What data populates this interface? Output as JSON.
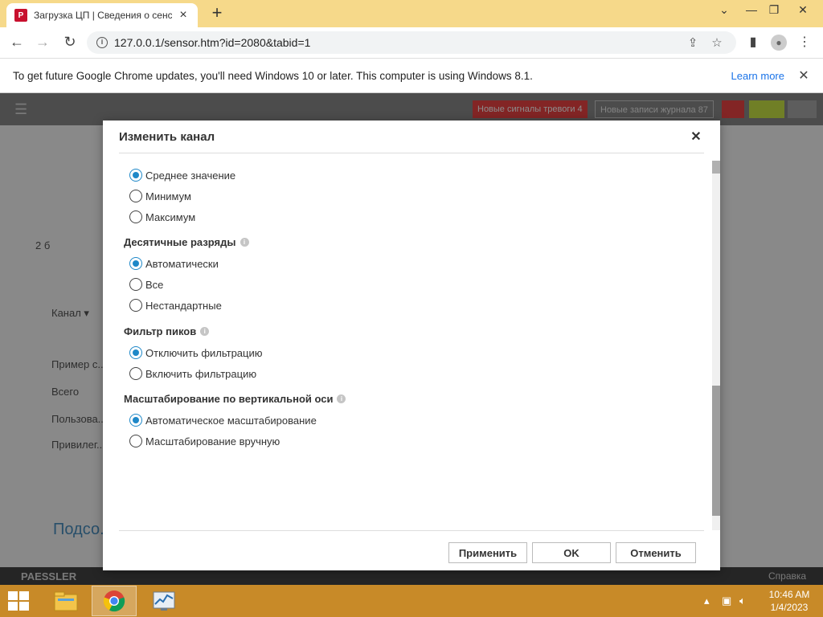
{
  "browser": {
    "tab_title": "Загрузка ЦП | Сведения о сенсоре",
    "tab_favicon": "P",
    "url": "127.0.0.1/sensor.htm?id=2080&tabid=1",
    "infobar_text": "To get future Google Chrome updates, you'll need Windows 10 or later. This computer is using Windows 8.1.",
    "infobar_link": "Learn more"
  },
  "page": {
    "alarm_1": "Новые сигналы тревоги 4",
    "alarm_2": "Новые записи журнала 87",
    "left_num": "2 б",
    "channel_label": "Канал ▾",
    "row_1": "Пример с...",
    "row_2": "Всего",
    "row_3": "Пользова...",
    "row_4": "Привилег...",
    "bottom_link": "Подсо...",
    "footer_logo": "PAESSLER",
    "footer_help": "Справка"
  },
  "modal": {
    "title": "Изменить канал",
    "group1_options": [
      {
        "label": "Среднее значение",
        "checked": true
      },
      {
        "label": "Минимум",
        "checked": false
      },
      {
        "label": "Максимум",
        "checked": false
      }
    ],
    "group2_label": "Десятичные разряды",
    "group2_options": [
      {
        "label": "Автоматически",
        "checked": true
      },
      {
        "label": "Все",
        "checked": false
      },
      {
        "label": "Нестандартные",
        "checked": false
      }
    ],
    "group3_label": "Фильтр пиков",
    "group3_options": [
      {
        "label": "Отключить фильтрацию",
        "checked": true
      },
      {
        "label": "Включить фильтрацию",
        "checked": false
      }
    ],
    "group4_label": "Масштабирование по вертикальной оси",
    "group4_options": [
      {
        "label": "Автоматическое масштабирование",
        "checked": true
      },
      {
        "label": "Масштабирование вручную",
        "checked": false
      }
    ],
    "apply_label": "Применить",
    "ok_label": "OK",
    "cancel_label": "Отменить"
  },
  "taskbar": {
    "time": "10:46 AM",
    "date": "1/4/2023"
  },
  "colors": {
    "accent": "#1e88c8",
    "taskbar": "#c88a28",
    "chrome_frame": "#f6d98a"
  }
}
